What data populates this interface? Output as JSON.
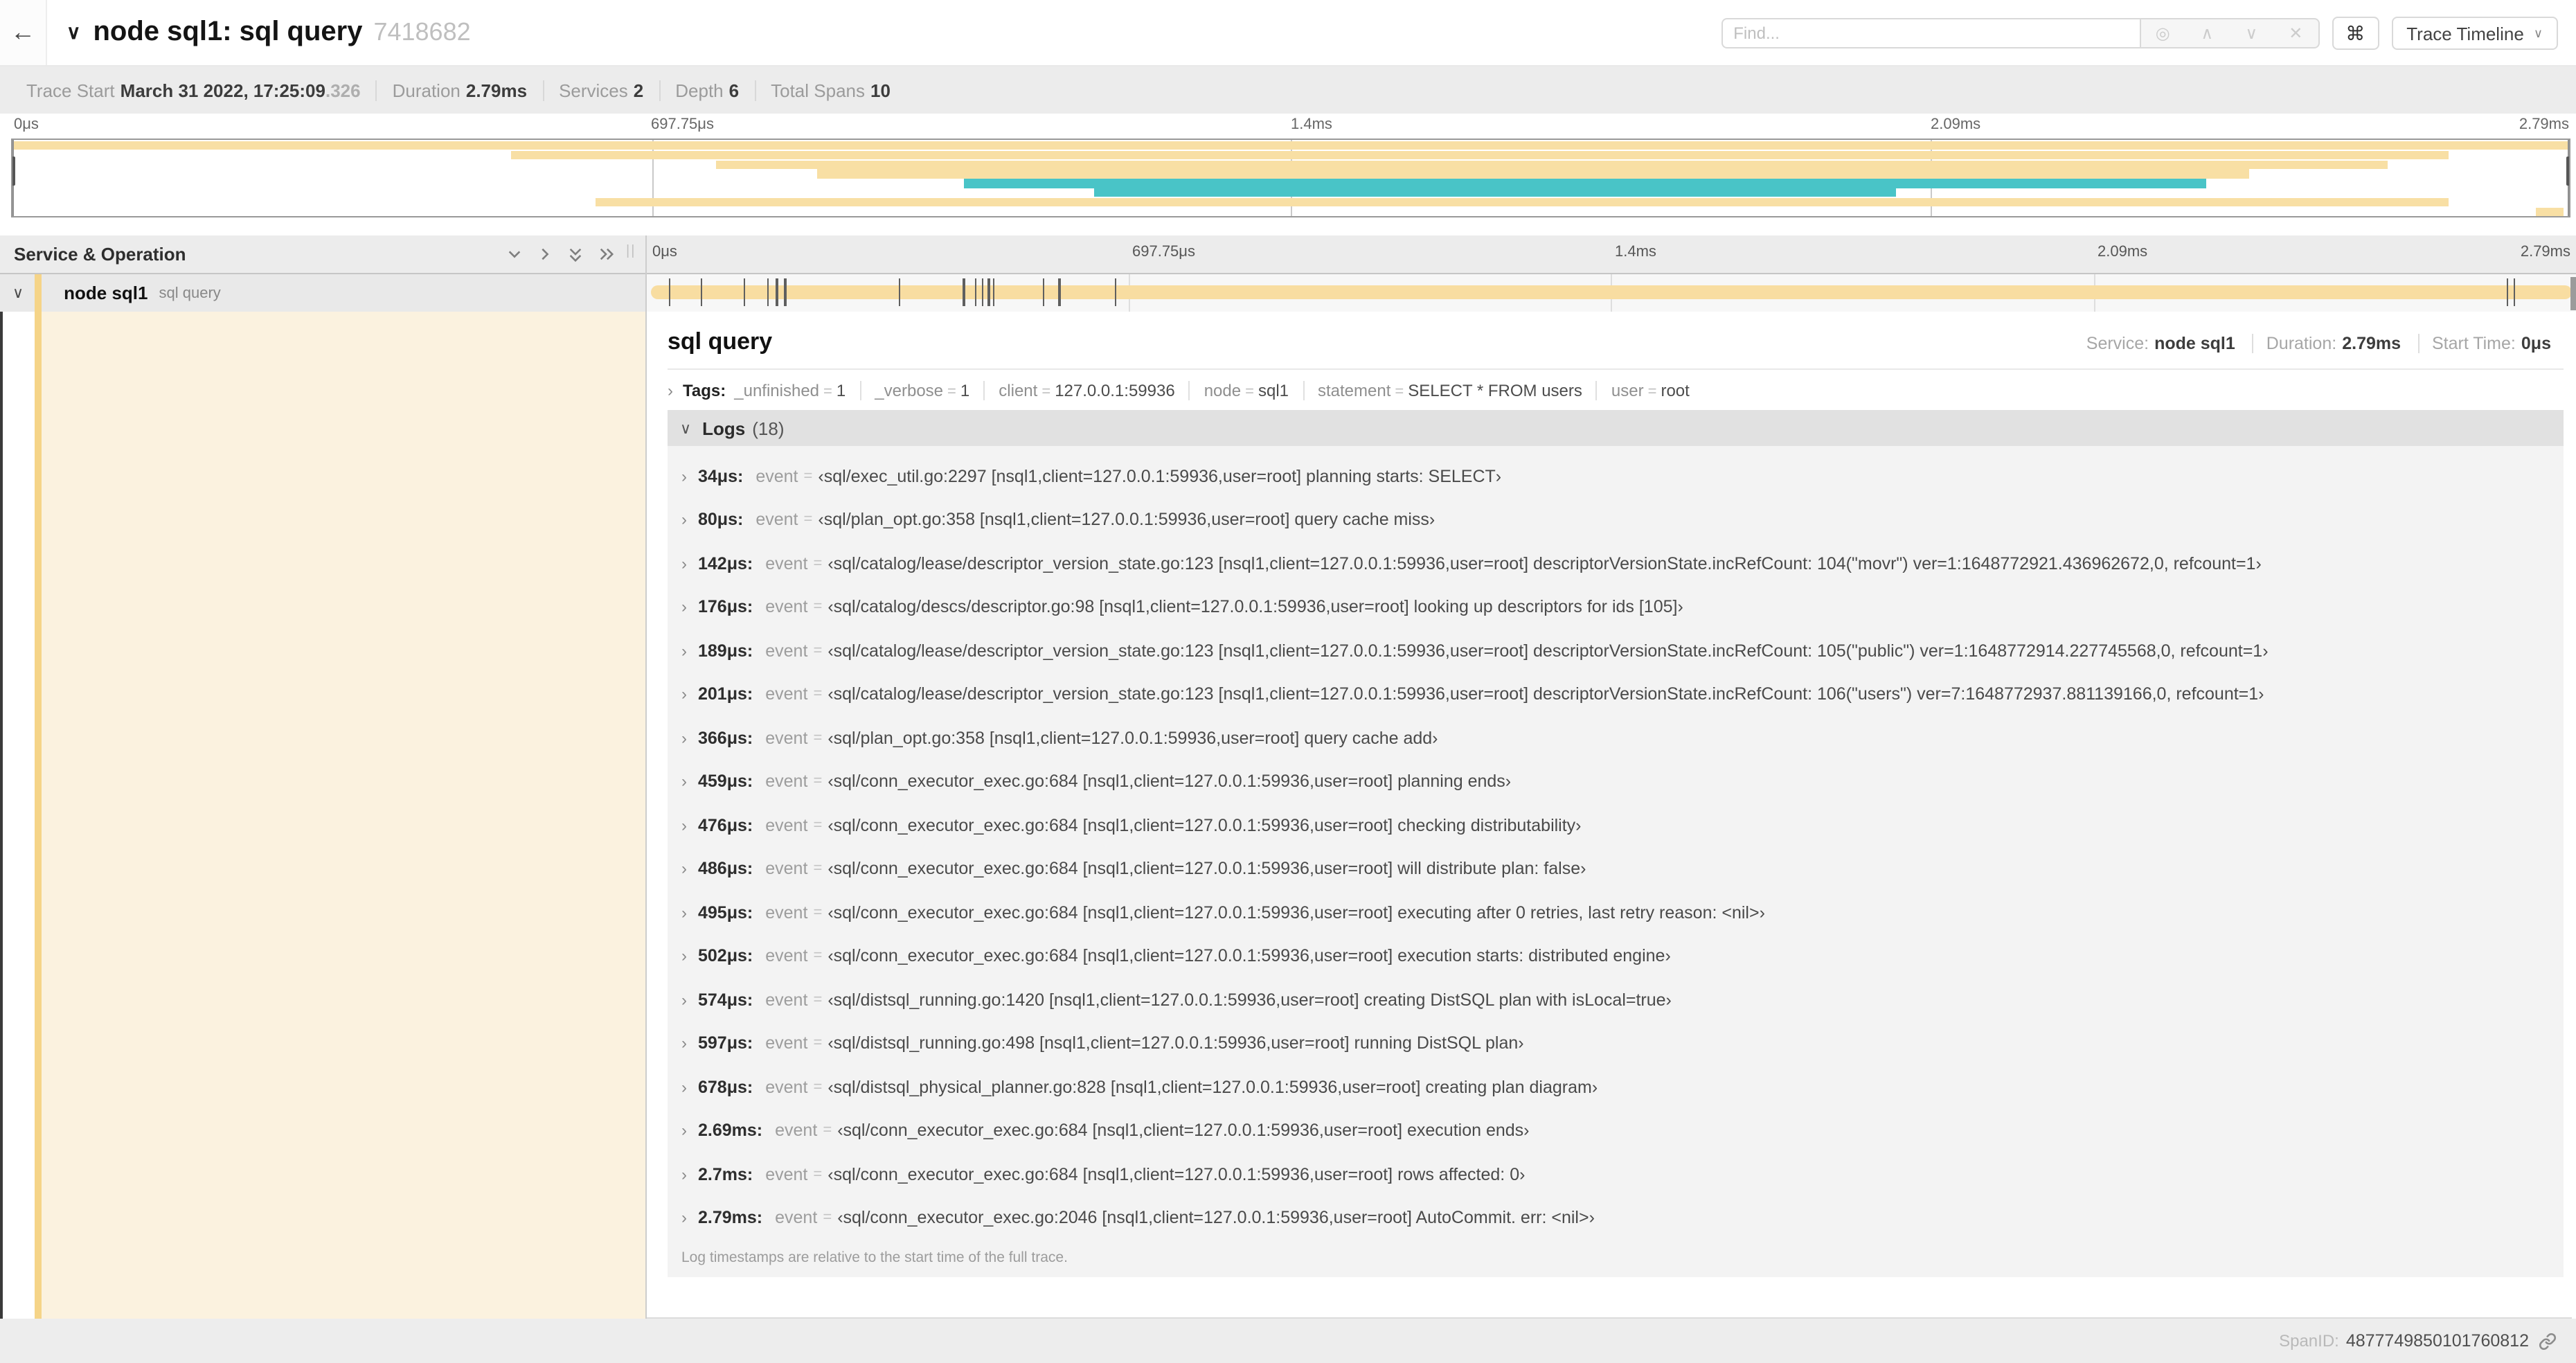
{
  "header": {
    "back_icon": "←",
    "collapse_icon": "∨",
    "title": "node sql1: sql query",
    "trace_id": "7418682",
    "find_placeholder": "Find...",
    "keyboard_shortcut_icon": "⌘",
    "view_selector_label": "Trace Timeline",
    "view_selector_caret": "∨"
  },
  "trace_info": {
    "items": [
      {
        "label": "Trace Start",
        "value": "March 31 2022, 17:25:09",
        "suffix": ".326"
      },
      {
        "label": "Duration",
        "value": "2.79ms"
      },
      {
        "label": "Services",
        "value": "2"
      },
      {
        "label": "Depth",
        "value": "6"
      },
      {
        "label": "Total Spans",
        "value": "10"
      }
    ]
  },
  "minimap": {
    "ticks": [
      "0μs",
      "697.75μs",
      "1.4ms",
      "2.09ms",
      "2.79ms"
    ],
    "colors": {
      "orange": "#f8dfa4",
      "teal": "#49c4c7"
    },
    "bars": [
      {
        "row": 0,
        "start": 0,
        "end": 100,
        "color": "#f8dfa4"
      },
      {
        "row": 1,
        "start": 19.5,
        "end": 95.3,
        "color": "#f8dfa4"
      },
      {
        "row": 2,
        "start": 27.5,
        "end": 92.9,
        "color": "#f8dfa4"
      },
      {
        "row": 3,
        "start": 31.5,
        "end": 87.5,
        "color": "#f8dfa4"
      },
      {
        "row": 4,
        "start": 37.2,
        "end": 85.8,
        "color": "#49c4c7"
      },
      {
        "row": 5,
        "start": 42.3,
        "end": 73.7,
        "color": "#49c4c7"
      },
      {
        "row": 6,
        "start": 22.8,
        "end": 95.3,
        "color": "#f8dfa4"
      },
      {
        "row": 7,
        "start": 98.7,
        "end": 99.8,
        "color": "#f8dfa4"
      }
    ]
  },
  "timeline_header": {
    "left_title": "Service & Operation",
    "ticks": [
      "0μs",
      "697.75μs",
      "1.4ms",
      "2.09ms",
      "2.79ms"
    ]
  },
  "span_row": {
    "collapse_icon": "∨",
    "service": "node sql1",
    "operation": "sql query",
    "bar_color": "#f8dda1",
    "marker_positions": [
      1.22,
      2.87,
      5.09,
      6.31,
      6.77,
      7.2,
      13.12,
      16.45,
      17.06,
      17.42,
      17.74,
      17.99,
      20.57,
      21.4,
      24.3,
      96.42,
      96.77,
      99.8
    ]
  },
  "detail": {
    "title": "sql query",
    "overview": [
      {
        "label": "Service:",
        "value": "node sql1"
      },
      {
        "label": "Duration:",
        "value": "2.79ms"
      },
      {
        "label": "Start Time:",
        "value": "0μs"
      }
    ],
    "tags": {
      "chevron": "›",
      "label": "Tags:",
      "eq": "=",
      "items": [
        {
          "key": "_unfinished",
          "value": "1"
        },
        {
          "key": "_verbose",
          "value": "1"
        },
        {
          "key": "client",
          "value": "127.0.0.1:59936"
        },
        {
          "key": "node",
          "value": "sql1"
        },
        {
          "key": "statement",
          "value": "SELECT * FROM users"
        },
        {
          "key": "user",
          "value": "root"
        }
      ]
    },
    "logs": {
      "chevron": "∨",
      "label": "Logs",
      "count": "(18)",
      "key_label": "event",
      "eq": "=",
      "row_chevron": "›",
      "rows": [
        {
          "time": "34μs:",
          "value": "‹sql/exec_util.go:2297 [nsql1,client=127.0.0.1:59936,user=root] planning starts: SELECT›"
        },
        {
          "time": "80μs:",
          "value": "‹sql/plan_opt.go:358 [nsql1,client=127.0.0.1:59936,user=root] query cache miss›"
        },
        {
          "time": "142μs:",
          "value": "‹sql/catalog/lease/descriptor_version_state.go:123 [nsql1,client=127.0.0.1:59936,user=root] descriptorVersionState.incRefCount: 104(\"movr\") ver=1:1648772921.436962672,0, refcount=1›"
        },
        {
          "time": "176μs:",
          "value": "‹sql/catalog/descs/descriptor.go:98 [nsql1,client=127.0.0.1:59936,user=root] looking up descriptors for ids [105]›"
        },
        {
          "time": "189μs:",
          "value": "‹sql/catalog/lease/descriptor_version_state.go:123 [nsql1,client=127.0.0.1:59936,user=root] descriptorVersionState.incRefCount: 105(\"public\") ver=1:1648772914.227745568,0, refcount=1›"
        },
        {
          "time": "201μs:",
          "value": "‹sql/catalog/lease/descriptor_version_state.go:123 [nsql1,client=127.0.0.1:59936,user=root] descriptorVersionState.incRefCount: 106(\"users\") ver=7:1648772937.881139166,0, refcount=1›"
        },
        {
          "time": "366μs:",
          "value": "‹sql/plan_opt.go:358 [nsql1,client=127.0.0.1:59936,user=root] query cache add›"
        },
        {
          "time": "459μs:",
          "value": "‹sql/conn_executor_exec.go:684 [nsql1,client=127.0.0.1:59936,user=root] planning ends›"
        },
        {
          "time": "476μs:",
          "value": "‹sql/conn_executor_exec.go:684 [nsql1,client=127.0.0.1:59936,user=root] checking distributability›"
        },
        {
          "time": "486μs:",
          "value": "‹sql/conn_executor_exec.go:684 [nsql1,client=127.0.0.1:59936,user=root] will distribute plan: false›"
        },
        {
          "time": "495μs:",
          "value": "‹sql/conn_executor_exec.go:684 [nsql1,client=127.0.0.1:59936,user=root] executing after 0 retries, last retry reason: <nil>›"
        },
        {
          "time": "502μs:",
          "value": "‹sql/conn_executor_exec.go:684 [nsql1,client=127.0.0.1:59936,user=root] execution starts: distributed engine›"
        },
        {
          "time": "574μs:",
          "value": "‹sql/distsql_running.go:1420 [nsql1,client=127.0.0.1:59936,user=root] creating DistSQL plan with isLocal=true›"
        },
        {
          "time": "597μs:",
          "value": "‹sql/distsql_running.go:498 [nsql1,client=127.0.0.1:59936,user=root] running DistSQL plan›"
        },
        {
          "time": "678μs:",
          "value": "‹sql/distsql_physical_planner.go:828 [nsql1,client=127.0.0.1:59936,user=root] creating plan diagram›"
        },
        {
          "time": "2.69ms:",
          "value": "‹sql/conn_executor_exec.go:684 [nsql1,client=127.0.0.1:59936,user=root] execution ends›"
        },
        {
          "time": "2.7ms:",
          "value": "‹sql/conn_executor_exec.go:684 [nsql1,client=127.0.0.1:59936,user=root] rows affected: 0›"
        },
        {
          "time": "2.79ms:",
          "value": "‹sql/conn_executor_exec.go:2046 [nsql1,client=127.0.0.1:59936,user=root] AutoCommit. err: <nil>›"
        }
      ],
      "footer": "Log timestamps are relative to the start time of the full trace."
    },
    "span_id_label": "SpanID:",
    "span_id": "4877749850101760812"
  }
}
